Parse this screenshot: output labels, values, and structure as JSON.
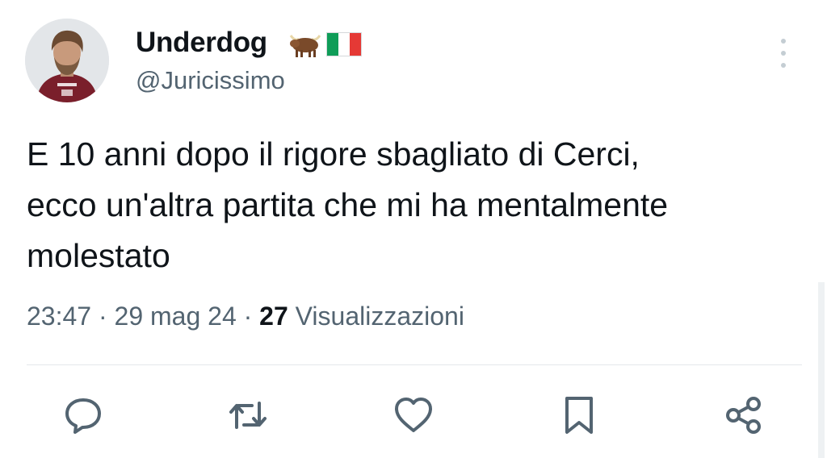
{
  "tweet": {
    "author": {
      "display_name": "Underdog",
      "name_badges": [
        "bull-emoji",
        "italy-flag-emoji"
      ],
      "handle": "@Juricissimo"
    },
    "text_lines": [
      "E 10 anni dopo il rigore sbagliato di Cerci,",
      "ecco un'altra partita che mi ha mentalmente",
      "molestato"
    ],
    "meta": {
      "time": "23:47",
      "separator": " · ",
      "date": "29 mag 24",
      "views_count": "27",
      "views_label": " Visualizzazioni"
    },
    "actions": [
      {
        "name": "reply",
        "icon": "speech-bubble-icon"
      },
      {
        "name": "retweet",
        "icon": "retweet-icon"
      },
      {
        "name": "like",
        "icon": "heart-icon"
      },
      {
        "name": "bookmark",
        "icon": "bookmark-icon"
      },
      {
        "name": "share",
        "icon": "share-nodes-icon"
      }
    ]
  },
  "colors": {
    "text_primary": "#0f1419",
    "text_secondary": "#536471",
    "icon": "#536471",
    "divider": "#e4e8eb",
    "jersey": "#7a1f2b"
  }
}
